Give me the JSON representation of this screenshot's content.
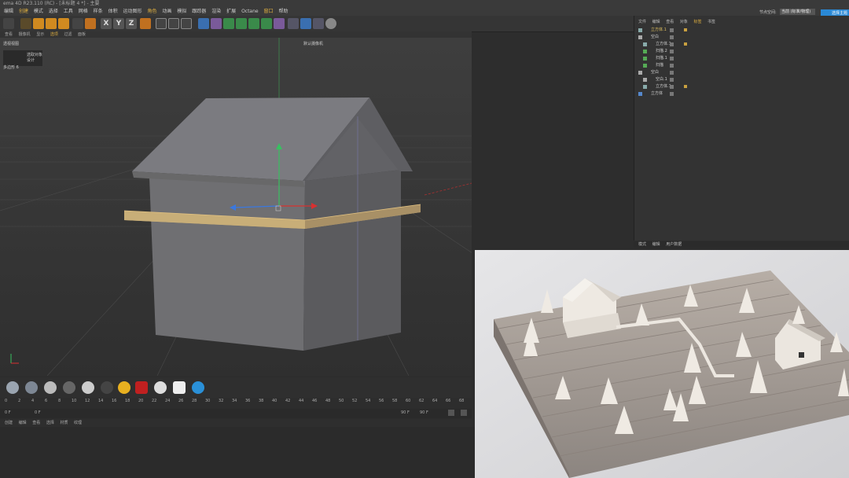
{
  "app": {
    "title": "ema 4D R23.110 (RC) - [未标题 4 *] - 主要"
  },
  "menu": [
    "编辑",
    "创建",
    "模式",
    "选择",
    "工具",
    "网格",
    "样条",
    "体积",
    "运动图形",
    "角色",
    "动画",
    "模拟",
    "跟踪器",
    "渲染",
    "扩展",
    "Octane",
    "窗口",
    "帮助"
  ],
  "top_right": {
    "layout_label": "节点空间:",
    "layout_value": "当前 (标准/物理)",
    "login_label": "选择主题"
  },
  "toolbar": {
    "axis_x": "X",
    "axis_y": "Y",
    "axis_z": "Z"
  },
  "viewport": {
    "menu": [
      "查看",
      "摄像机",
      "显示",
      "选项",
      "过滤",
      "面板"
    ],
    "label": "透视视图",
    "camera": "默认摄像机",
    "hint_mode": "选取对象",
    "hint_action": "设计",
    "param_label": "多边形",
    "param_value": "6"
  },
  "object_manager": {
    "menu": [
      "文件",
      "编辑",
      "查看",
      "对象",
      "标签",
      "书签"
    ],
    "objects": [
      {
        "name": "立方体.1",
        "level": 0,
        "color": "#e0c060"
      },
      {
        "name": "空白",
        "level": 0,
        "color": "#cfcfcf"
      },
      {
        "name": "立方体.1",
        "level": 1,
        "color": "#cfcfcf"
      },
      {
        "name": "扫描.2",
        "level": 1,
        "color": "#cfcfcf"
      },
      {
        "name": "扫描.1",
        "level": 1,
        "color": "#cfcfcf"
      },
      {
        "name": "扫描",
        "level": 1,
        "color": "#cfcfcf"
      },
      {
        "name": "空白",
        "level": 0,
        "color": "#cfcfcf"
      },
      {
        "name": "空白.1",
        "level": 1,
        "color": "#cfcfcf"
      },
      {
        "name": "立方体.1",
        "level": 1,
        "color": "#cfcfcf"
      },
      {
        "name": "立方体",
        "level": 0,
        "color": "#cfcfcf"
      }
    ]
  },
  "attribute_manager": {
    "menu": [
      "模式",
      "编辑",
      "用户数据"
    ]
  },
  "timeline": {
    "ticks": [
      "0",
      "2",
      "4",
      "6",
      "8",
      "10",
      "12",
      "14",
      "16",
      "18",
      "20",
      "22",
      "24",
      "26",
      "28",
      "30",
      "32",
      "34",
      "36",
      "38",
      "40",
      "42",
      "44",
      "46",
      "48",
      "50",
      "52",
      "54",
      "56",
      "58",
      "60",
      "62",
      "64",
      "66",
      "68"
    ],
    "start_frame": "0 F",
    "current_frame": "0 F",
    "end_frame": "90 F",
    "end_frame2": "90 F"
  },
  "bottom_menu": [
    "创建",
    "编辑",
    "查看",
    "选择",
    "材质",
    "纹理"
  ]
}
